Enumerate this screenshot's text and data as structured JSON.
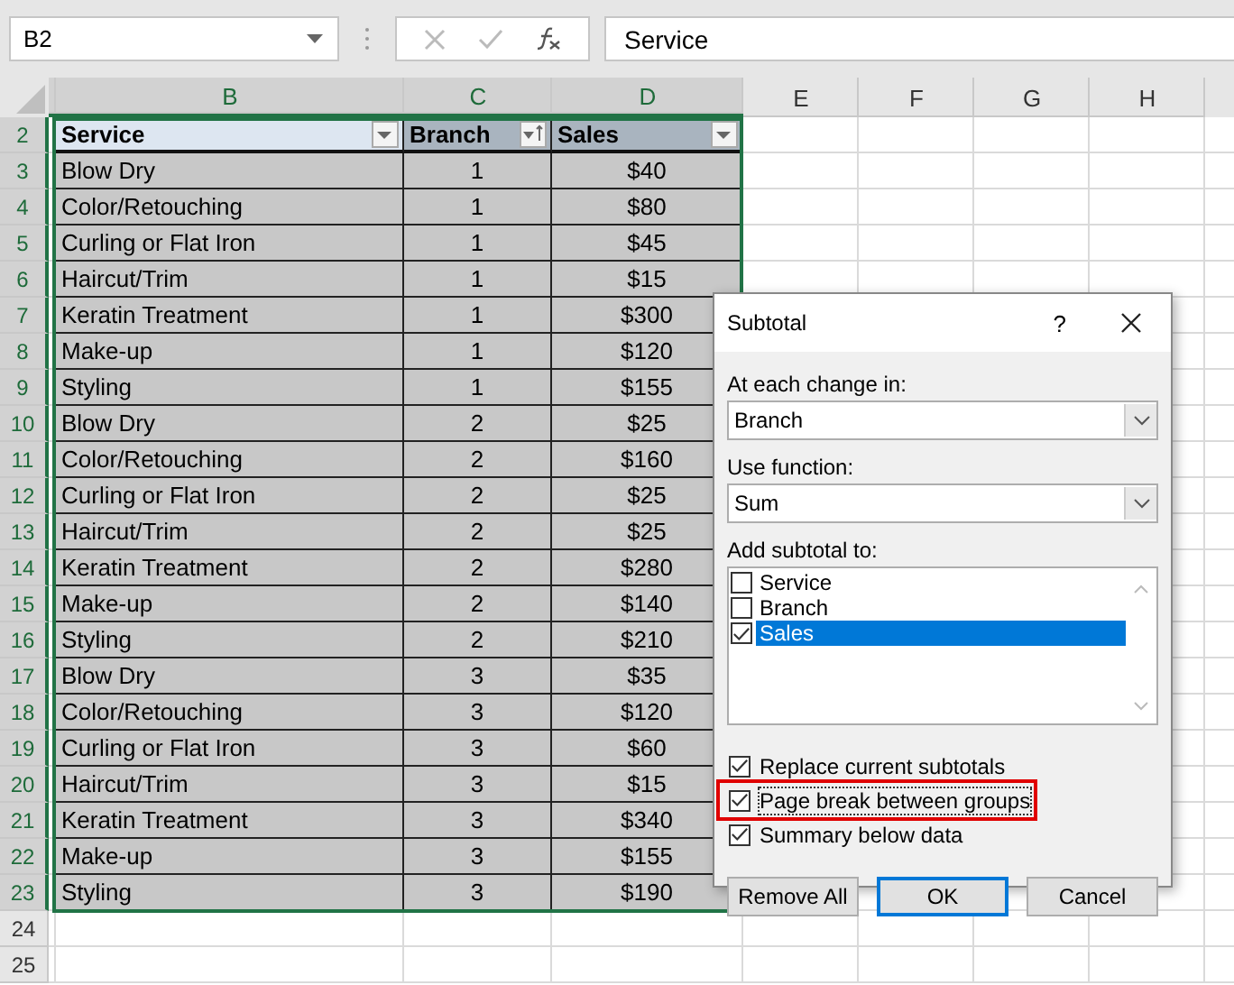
{
  "formula_bar": {
    "name_box": "B2",
    "value": "Service"
  },
  "columns": [
    {
      "label": "B",
      "selected": true
    },
    {
      "label": "C",
      "selected": true
    },
    {
      "label": "D",
      "selected": true
    },
    {
      "label": "E",
      "selected": false
    },
    {
      "label": "F",
      "selected": false
    },
    {
      "label": "G",
      "selected": false
    },
    {
      "label": "H",
      "selected": false
    }
  ],
  "table": {
    "row": "2",
    "headers": [
      {
        "label": "Service",
        "sorted": false
      },
      {
        "label": "Branch",
        "sorted": true
      },
      {
        "label": "Sales",
        "sorted": false
      }
    ],
    "rows": [
      {
        "row": "3",
        "service": "Blow Dry",
        "branch": "1",
        "sales": "$40"
      },
      {
        "row": "4",
        "service": "Color/Retouching",
        "branch": "1",
        "sales": "$80"
      },
      {
        "row": "5",
        "service": "Curling or Flat Iron",
        "branch": "1",
        "sales": "$45"
      },
      {
        "row": "6",
        "service": "Haircut/Trim",
        "branch": "1",
        "sales": "$15"
      },
      {
        "row": "7",
        "service": "Keratin Treatment",
        "branch": "1",
        "sales": "$300"
      },
      {
        "row": "8",
        "service": "Make-up",
        "branch": "1",
        "sales": "$120"
      },
      {
        "row": "9",
        "service": "Styling",
        "branch": "1",
        "sales": "$155"
      },
      {
        "row": "10",
        "service": "Blow Dry",
        "branch": "2",
        "sales": "$25"
      },
      {
        "row": "11",
        "service": "Color/Retouching",
        "branch": "2",
        "sales": "$160"
      },
      {
        "row": "12",
        "service": "Curling or Flat Iron",
        "branch": "2",
        "sales": "$25"
      },
      {
        "row": "13",
        "service": "Haircut/Trim",
        "branch": "2",
        "sales": "$25"
      },
      {
        "row": "14",
        "service": "Keratin Treatment",
        "branch": "2",
        "sales": "$280"
      },
      {
        "row": "15",
        "service": "Make-up",
        "branch": "2",
        "sales": "$140"
      },
      {
        "row": "16",
        "service": "Styling",
        "branch": "2",
        "sales": "$210"
      },
      {
        "row": "17",
        "service": "Blow Dry",
        "branch": "3",
        "sales": "$35"
      },
      {
        "row": "18",
        "service": "Color/Retouching",
        "branch": "3",
        "sales": "$120"
      },
      {
        "row": "19",
        "service": "Curling or Flat Iron",
        "branch": "3",
        "sales": "$60"
      },
      {
        "row": "20",
        "service": "Haircut/Trim",
        "branch": "3",
        "sales": "$15"
      },
      {
        "row": "21",
        "service": "Keratin Treatment",
        "branch": "3",
        "sales": "$340"
      },
      {
        "row": "22",
        "service": "Make-up",
        "branch": "3",
        "sales": "$155"
      },
      {
        "row": "23",
        "service": "Styling",
        "branch": "3",
        "sales": "$190"
      }
    ]
  },
  "empty_rows": [
    "24",
    "25"
  ],
  "dialog": {
    "title": "Subtotal",
    "help": "?",
    "change_label": "At each change in:",
    "change_value": "Branch",
    "function_label": "Use function:",
    "function_value": "Sum",
    "add_label": "Add subtotal to:",
    "add_items": [
      {
        "label": "Service",
        "checked": false,
        "selected": false
      },
      {
        "label": "Branch",
        "checked": false,
        "selected": false
      },
      {
        "label": "Sales",
        "checked": true,
        "selected": true
      }
    ],
    "options": [
      {
        "label": "Replace current subtotals",
        "checked": true,
        "highlighted": false
      },
      {
        "label": "Page break between groups",
        "checked": true,
        "highlighted": true
      },
      {
        "label": "Summary below data",
        "checked": true,
        "highlighted": false
      }
    ],
    "buttons": [
      {
        "label": "Remove All",
        "default": false
      },
      {
        "label": "OK",
        "default": true
      },
      {
        "label": "Cancel",
        "default": false
      }
    ]
  }
}
